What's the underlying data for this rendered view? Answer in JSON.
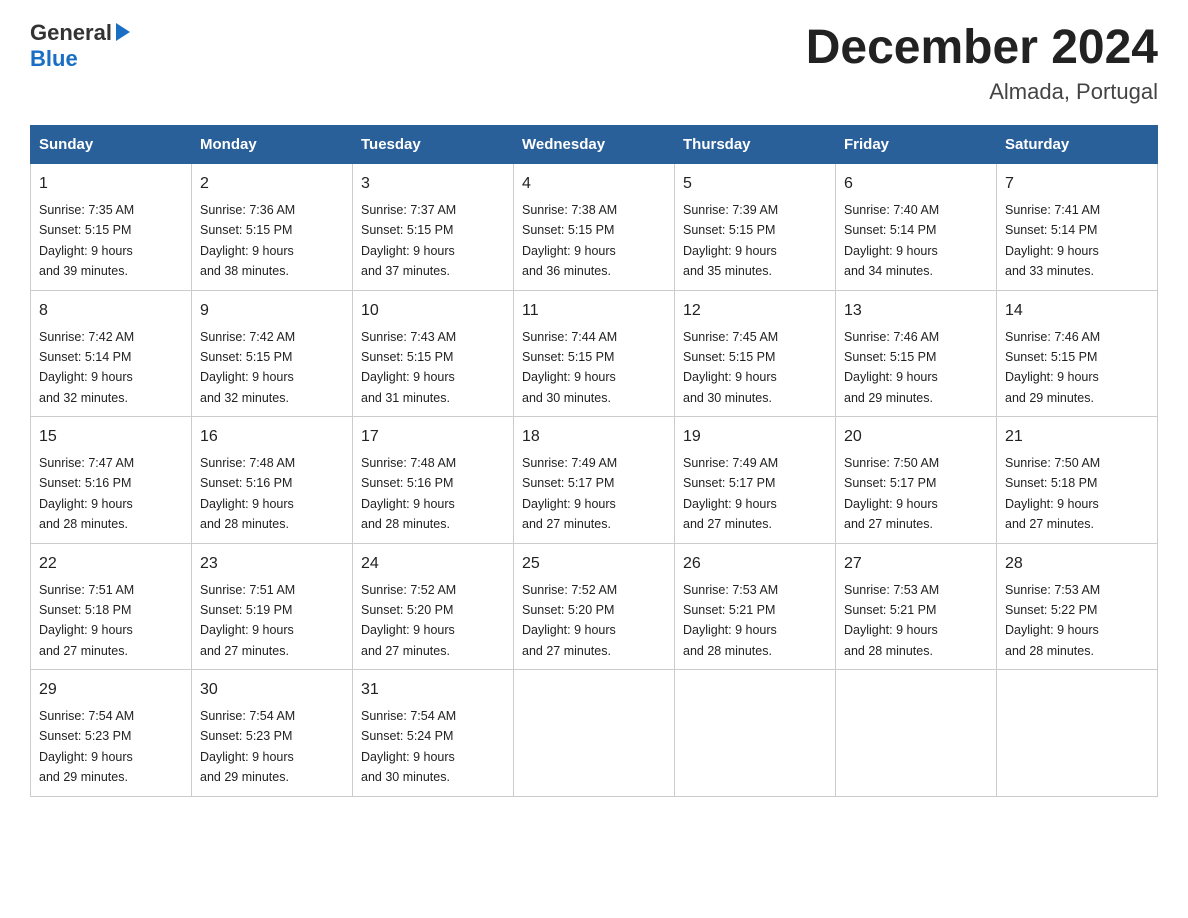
{
  "logo": {
    "general": "General",
    "blue": "Blue"
  },
  "title": "December 2024",
  "subtitle": "Almada, Portugal",
  "days_of_week": [
    "Sunday",
    "Monday",
    "Tuesday",
    "Wednesday",
    "Thursday",
    "Friday",
    "Saturday"
  ],
  "weeks": [
    [
      {
        "day": "1",
        "sunrise": "7:35 AM",
        "sunset": "5:15 PM",
        "daylight": "9 hours and 39 minutes."
      },
      {
        "day": "2",
        "sunrise": "7:36 AM",
        "sunset": "5:15 PM",
        "daylight": "9 hours and 38 minutes."
      },
      {
        "day": "3",
        "sunrise": "7:37 AM",
        "sunset": "5:15 PM",
        "daylight": "9 hours and 37 minutes."
      },
      {
        "day": "4",
        "sunrise": "7:38 AM",
        "sunset": "5:15 PM",
        "daylight": "9 hours and 36 minutes."
      },
      {
        "day": "5",
        "sunrise": "7:39 AM",
        "sunset": "5:15 PM",
        "daylight": "9 hours and 35 minutes."
      },
      {
        "day": "6",
        "sunrise": "7:40 AM",
        "sunset": "5:14 PM",
        "daylight": "9 hours and 34 minutes."
      },
      {
        "day": "7",
        "sunrise": "7:41 AM",
        "sunset": "5:14 PM",
        "daylight": "9 hours and 33 minutes."
      }
    ],
    [
      {
        "day": "8",
        "sunrise": "7:42 AM",
        "sunset": "5:14 PM",
        "daylight": "9 hours and 32 minutes."
      },
      {
        "day": "9",
        "sunrise": "7:42 AM",
        "sunset": "5:15 PM",
        "daylight": "9 hours and 32 minutes."
      },
      {
        "day": "10",
        "sunrise": "7:43 AM",
        "sunset": "5:15 PM",
        "daylight": "9 hours and 31 minutes."
      },
      {
        "day": "11",
        "sunrise": "7:44 AM",
        "sunset": "5:15 PM",
        "daylight": "9 hours and 30 minutes."
      },
      {
        "day": "12",
        "sunrise": "7:45 AM",
        "sunset": "5:15 PM",
        "daylight": "9 hours and 30 minutes."
      },
      {
        "day": "13",
        "sunrise": "7:46 AM",
        "sunset": "5:15 PM",
        "daylight": "9 hours and 29 minutes."
      },
      {
        "day": "14",
        "sunrise": "7:46 AM",
        "sunset": "5:15 PM",
        "daylight": "9 hours and 29 minutes."
      }
    ],
    [
      {
        "day": "15",
        "sunrise": "7:47 AM",
        "sunset": "5:16 PM",
        "daylight": "9 hours and 28 minutes."
      },
      {
        "day": "16",
        "sunrise": "7:48 AM",
        "sunset": "5:16 PM",
        "daylight": "9 hours and 28 minutes."
      },
      {
        "day": "17",
        "sunrise": "7:48 AM",
        "sunset": "5:16 PM",
        "daylight": "9 hours and 28 minutes."
      },
      {
        "day": "18",
        "sunrise": "7:49 AM",
        "sunset": "5:17 PM",
        "daylight": "9 hours and 27 minutes."
      },
      {
        "day": "19",
        "sunrise": "7:49 AM",
        "sunset": "5:17 PM",
        "daylight": "9 hours and 27 minutes."
      },
      {
        "day": "20",
        "sunrise": "7:50 AM",
        "sunset": "5:17 PM",
        "daylight": "9 hours and 27 minutes."
      },
      {
        "day": "21",
        "sunrise": "7:50 AM",
        "sunset": "5:18 PM",
        "daylight": "9 hours and 27 minutes."
      }
    ],
    [
      {
        "day": "22",
        "sunrise": "7:51 AM",
        "sunset": "5:18 PM",
        "daylight": "9 hours and 27 minutes."
      },
      {
        "day": "23",
        "sunrise": "7:51 AM",
        "sunset": "5:19 PM",
        "daylight": "9 hours and 27 minutes."
      },
      {
        "day": "24",
        "sunrise": "7:52 AM",
        "sunset": "5:20 PM",
        "daylight": "9 hours and 27 minutes."
      },
      {
        "day": "25",
        "sunrise": "7:52 AM",
        "sunset": "5:20 PM",
        "daylight": "9 hours and 27 minutes."
      },
      {
        "day": "26",
        "sunrise": "7:53 AM",
        "sunset": "5:21 PM",
        "daylight": "9 hours and 28 minutes."
      },
      {
        "day": "27",
        "sunrise": "7:53 AM",
        "sunset": "5:21 PM",
        "daylight": "9 hours and 28 minutes."
      },
      {
        "day": "28",
        "sunrise": "7:53 AM",
        "sunset": "5:22 PM",
        "daylight": "9 hours and 28 minutes."
      }
    ],
    [
      {
        "day": "29",
        "sunrise": "7:54 AM",
        "sunset": "5:23 PM",
        "daylight": "9 hours and 29 minutes."
      },
      {
        "day": "30",
        "sunrise": "7:54 AM",
        "sunset": "5:23 PM",
        "daylight": "9 hours and 29 minutes."
      },
      {
        "day": "31",
        "sunrise": "7:54 AM",
        "sunset": "5:24 PM",
        "daylight": "9 hours and 30 minutes."
      },
      null,
      null,
      null,
      null
    ]
  ],
  "labels": {
    "sunrise": "Sunrise:",
    "sunset": "Sunset:",
    "daylight": "Daylight:"
  }
}
